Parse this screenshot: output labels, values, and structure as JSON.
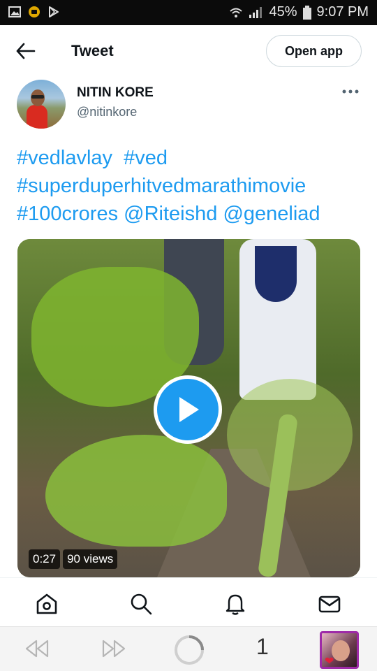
{
  "status_bar": {
    "battery": "45%",
    "time": "9:07 PM",
    "icons": [
      "gallery-icon",
      "app-notification-icon",
      "play-store-icon",
      "wifi-icon",
      "signal-icon",
      "battery-icon"
    ]
  },
  "header": {
    "title": "Tweet",
    "open_app_label": "Open app"
  },
  "author": {
    "name": "NITIN KORE",
    "handle": "@nitinkore"
  },
  "tweet": {
    "lines": [
      [
        "#vedlavlay",
        "#ved"
      ],
      [
        "#superduperhitvedmarathimovie"
      ],
      [
        "#100crores",
        "@Riteishd",
        "@geneliad"
      ]
    ]
  },
  "media": {
    "duration": "0:27",
    "views": "90 views"
  },
  "tab_bar": {
    "items": [
      "home-icon",
      "search-icon",
      "notifications-icon",
      "messages-icon"
    ]
  },
  "browser_bar": {
    "tab_count": "1"
  },
  "colors": {
    "accent": "#1d9bf0",
    "text": "#0f1419",
    "secondary": "#536471",
    "status_bar_bg": "#0b0b0b"
  }
}
